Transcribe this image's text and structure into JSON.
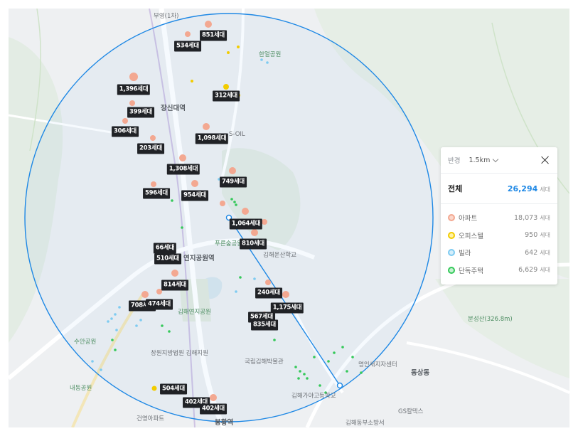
{
  "panel": {
    "radius_label": "반경",
    "radius_value": "1.5km",
    "total_label": "전체",
    "total_value": "26,294",
    "unit": "세대",
    "rows": [
      {
        "label": "아파트",
        "value": "18,073",
        "color": "#f3a891"
      },
      {
        "label": "오피스텔",
        "value": "950",
        "color": "#f2cc00"
      },
      {
        "label": "빌라",
        "value": "642",
        "color": "#7ecbf1"
      },
      {
        "label": "단독주택",
        "value": "6,629",
        "color": "#35c95a"
      }
    ]
  },
  "map": {
    "circle_color": "#1e88e5",
    "labels": [
      "851세대",
      "534세대",
      "1,396세대",
      "312세대",
      "399세대",
      "306세대",
      "1,098세대",
      "203세대",
      "1,308세대",
      "749세대",
      "596세대",
      "954세대",
      "1,064세대",
      "810세대",
      "66세대",
      "510세대",
      "814세대",
      "240세대",
      "708세대",
      "474세대",
      "1,175세대",
      "567세대",
      "835세대",
      "504세대",
      "402세대",
      "402세대"
    ],
    "places": [
      "장신대역",
      "연지공원역",
      "봉황역",
      "동상동",
      "수안공원",
      "내동공원",
      "김해연지공원",
      "S-OIL",
      "국립김해박물관",
      "김해가야고등학교",
      "김해운산학교",
      "GS칼텍스",
      "분성산(326.8m)",
      "한얼공원",
      "푸른숲공원",
      "창원지방법원 김해지원",
      "명인새지자센터",
      "김해동부소방서",
      "건영아파트",
      "부영(1차)"
    ]
  }
}
